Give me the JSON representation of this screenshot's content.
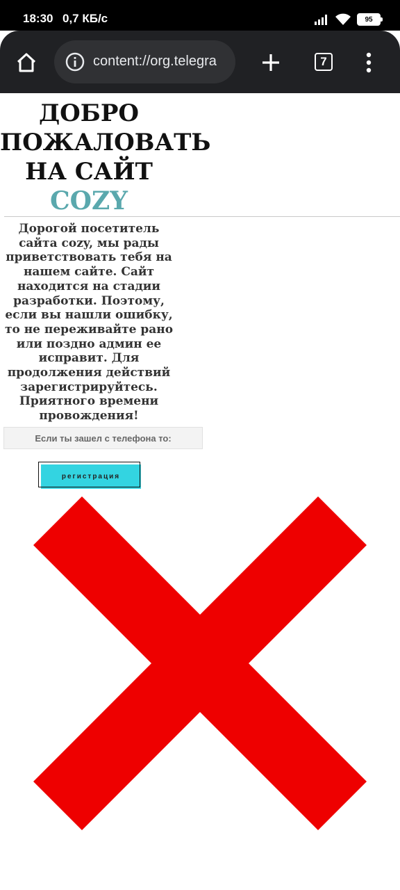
{
  "status_bar": {
    "time": "18:30",
    "speed": "0,7 КБ/с",
    "battery": "95"
  },
  "browser": {
    "url": "content://org.telegra",
    "tab_count": "7",
    "icons": [
      "home-icon",
      "info-icon",
      "plus-icon",
      "tabs-icon",
      "more-vert-icon"
    ]
  },
  "page": {
    "welcome_line1": "ДОБРО",
    "welcome_line2": "ПОЖАЛОВАТЬ",
    "welcome_line3": "НА САЙТ",
    "welcome_brand": "COZY",
    "brand_color": "#5aa8ad",
    "message": "Дорогой посетитель сайта cozy, мы рады приветствовать тебя на нашем сайте. Сайт находится на стадии разработки. Поэтому, если вы нашли ошибку, то не переживайте рано или поздно админ ее исправит. Для продолжения действий зарегистрируйтесь. Приятного времени провождения!",
    "phone_note": "Если ты зашел с телефона то:",
    "register_label": "регистрация",
    "register_color": "#33d4e1",
    "cross_color": "#ee0000",
    "cross_icon": "red-x-icon"
  }
}
